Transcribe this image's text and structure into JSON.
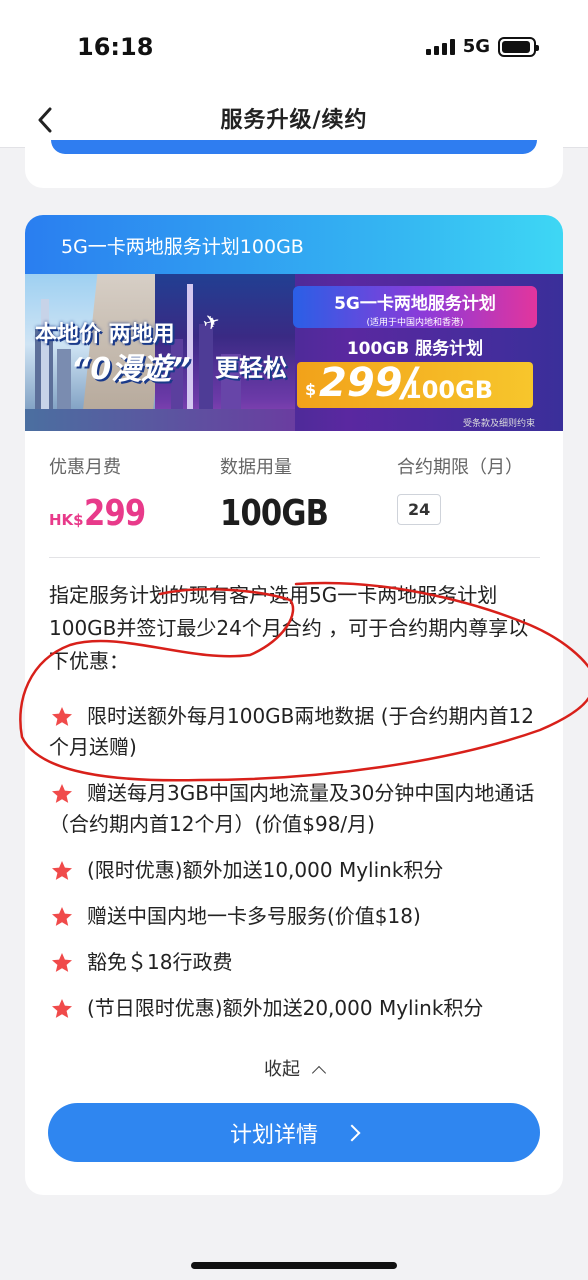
{
  "status_bar": {
    "time": "16:18",
    "network": "5G"
  },
  "nav": {
    "title": "服务升级/续约"
  },
  "card": {
    "header_title": "5G一卡两地服务计划100GB",
    "banner": {
      "headline_line1": "本地价 两地用",
      "headline_line2": "“0漫遊”",
      "headline_line3": "更轻松",
      "promo_title": "5G一卡两地服务计划",
      "promo_subtitle": "(适用于中国内地和香港)",
      "promo_plan": "100GB 服务计划",
      "promo_currency": "$",
      "promo_price": "299/",
      "promo_unit": "100GB",
      "promo_terms": "受条款及细则约束"
    },
    "stats": {
      "fee_label": "优惠月费",
      "fee_currency": "HK$",
      "fee_value": "299",
      "usage_label": "数据用量",
      "usage_value": "100GB",
      "term_label": "合约期限（月）",
      "term_value": "24"
    },
    "description": "指定服务计划的现有客户选用5G一卡两地服务计划100GB并签订最少24个月合约 ，可于合约期内尊享以下优惠：",
    "benefits": [
      "限时送额外每月100GB兩地数据 (于合约期内首12个月送赠)",
      "赠送每月3GB中国内地流量及30分钟中国内地通话（合约期内首12个月）(价值$98/月)",
      "(限时优惠)额外加送10,000 Mylink积分",
      "赠送中国内地一卡多号服务(价值$18)",
      "豁免＄18行政费",
      "(节日限时优惠)额外加送20,000 Mylink积分"
    ],
    "collapse_label": "收起",
    "details_button": "计划详情"
  },
  "colors": {
    "accent": "#2f86f0",
    "price_pink": "#e83a8a",
    "star_red": "#f04a4a",
    "annotation_red": "#d8201a"
  }
}
